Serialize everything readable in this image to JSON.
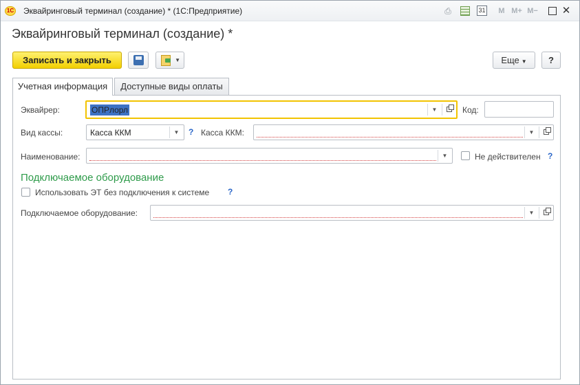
{
  "window": {
    "logo_text": "1С",
    "title": "Эквайринговый терминал (создание) * (1С:Предприятие)",
    "icons": [
      "print-icon",
      "calculator-icon",
      "calendar-icon",
      "memory-m-icon",
      "memory-plus-icon",
      "memory-minus-icon",
      "maximize-icon",
      "close-icon"
    ],
    "calendar_day": "31",
    "m_label": "M",
    "mplus_label": "M+",
    "mminus_label": "M−",
    "close_glyph": "✕"
  },
  "form": {
    "title": "Эквайринговый терминал (создание) *"
  },
  "toolbar": {
    "save_close_label": "Записать и закрыть",
    "more_label": "Еще",
    "help_label": "?"
  },
  "tabs": [
    {
      "label": "Учетная информация",
      "active": true
    },
    {
      "label": "Доступные виды оплаты",
      "active": false
    }
  ],
  "fields": {
    "acquirer_label": "Эквайрер:",
    "acquirer_value": "ОПРлорл",
    "code_label": "Код:",
    "code_value": "",
    "cash_type_label": "Вид кассы:",
    "cash_type_value": "Касса ККМ",
    "cash_register_label": "Касса ККМ:",
    "cash_register_value": "",
    "name_label": "Наименование:",
    "name_value": "",
    "inactive_label": "Не действителен",
    "inactive_checked": false,
    "help_mark": "?"
  },
  "equipment": {
    "section_title": "Подключаемое оборудование",
    "use_without_label": "Использовать ЭТ без подключения к системе",
    "use_without_checked": false,
    "equipment_label": "Подключаемое оборудование:",
    "equipment_value": ""
  },
  "colors": {
    "accent_yellow": "#f2cf00",
    "section_green": "#2e9b4a",
    "help_blue": "#2a66c8",
    "required_red": "#d23a3a"
  }
}
